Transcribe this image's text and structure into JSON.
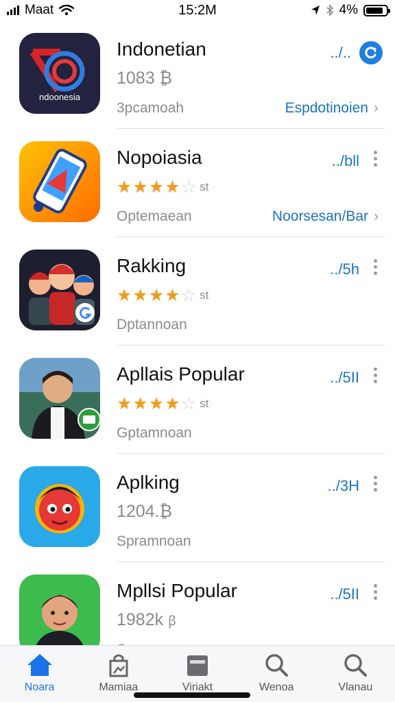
{
  "status_bar": {
    "carrier": "Maat",
    "time": "15:2M",
    "battery_text": "4%",
    "battery_level": 0.85
  },
  "apps": [
    {
      "title": "Indonetian",
      "line2": "1083 ₿",
      "subtitle": "3pcamoah",
      "size": "../..",
      "link": "Espdotinoien",
      "icon": "indonesia-logo-icon"
    },
    {
      "title": "Nopoiasia",
      "rating_stars": 3.5,
      "rating_suffix": "st",
      "subtitle": "Optemaean",
      "size": "../bll",
      "link": "Noorsesan/Bar",
      "icon": "cartoon-phone-icon"
    },
    {
      "title": "Rakking",
      "rating_stars": 3.5,
      "rating_suffix": "st",
      "subtitle": "Dptannoan",
      "size": "../5h",
      "icon": "cartoon-family-icon"
    },
    {
      "title": "Apllais Popular",
      "rating_stars": 3.5,
      "rating_suffix": "st",
      "subtitle": "Gptamnoan",
      "size": "../5II",
      "icon": "man-portrait-icon"
    },
    {
      "title": "Aplking",
      "line2": "1204.₿",
      "subtitle": "Spramnoan",
      "size": "../3H",
      "icon": "cartoon-character-icon"
    },
    {
      "title": "Mpllsi Popular",
      "line2": "1982k",
      "line2_suffix": "ꞵ",
      "subtitle": "Spramnoan",
      "size": "../5II",
      "icon": "boy-portrait-icon"
    }
  ],
  "tab_bar": {
    "tabs": [
      {
        "label": "Noara",
        "icon": "home-icon",
        "active": true
      },
      {
        "label": "Mamiaa",
        "icon": "store-icon",
        "active": false
      },
      {
        "label": "Viriakt",
        "icon": "calendar-icon",
        "active": false
      },
      {
        "label": "Wenoa",
        "icon": "search-icon",
        "active": false
      },
      {
        "label": "Vlanau",
        "icon": "search-icon",
        "active": false
      }
    ]
  },
  "colors": {
    "accent": "#1a73c8",
    "star": "#f29a1a",
    "active_tab": "#1a73e8"
  }
}
